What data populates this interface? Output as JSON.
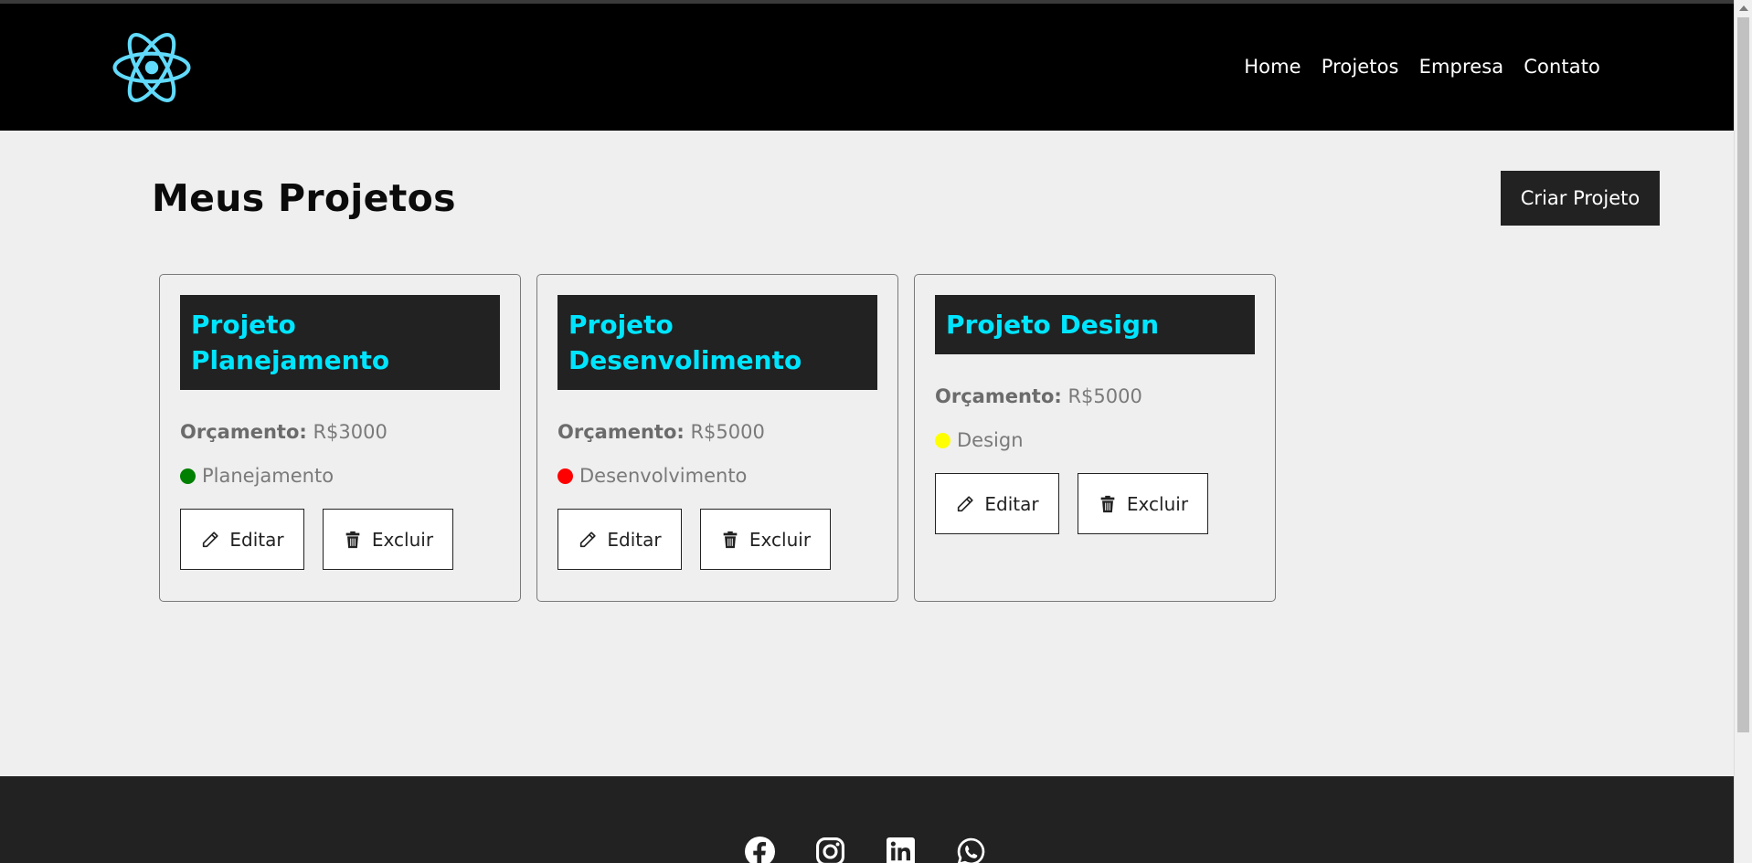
{
  "nav": {
    "logo_icon": "react-atom-logo-icon",
    "logo_color": "#61dafb",
    "links": [
      "Home",
      "Projetos",
      "Empresa",
      "Contato"
    ]
  },
  "main": {
    "title": "Meus Projetos",
    "create_button": "Criar Projeto"
  },
  "projects": [
    {
      "title": "Projeto Planejamento",
      "budget_label": "Orçamento:",
      "budget_value": "R$3000",
      "category": "Planejamento",
      "category_color": "#008000",
      "edit_label": "Editar",
      "delete_label": "Excluir"
    },
    {
      "title": "Projeto Desenvolimento",
      "budget_label": "Orçamento:",
      "budget_value": "R$5000",
      "category": "Desenvolvimento",
      "category_color": "#ff0000",
      "edit_label": "Editar",
      "delete_label": "Excluir"
    },
    {
      "title": "Projeto Design",
      "budget_label": "Orçamento:",
      "budget_value": "R$5000",
      "category": "Design",
      "category_color": "#ffff00",
      "edit_label": "Editar",
      "delete_label": "Excluir"
    }
  ],
  "footer": {
    "social_icons": [
      "facebook-icon",
      "instagram-icon",
      "linkedin-icon",
      "whatsapp-icon"
    ]
  },
  "colors": {
    "navbar_bg": "#000000",
    "card_title_bg": "#222222",
    "card_title_text": "#00e5ff",
    "page_bg": "#efefef",
    "footer_bg": "#222222"
  }
}
